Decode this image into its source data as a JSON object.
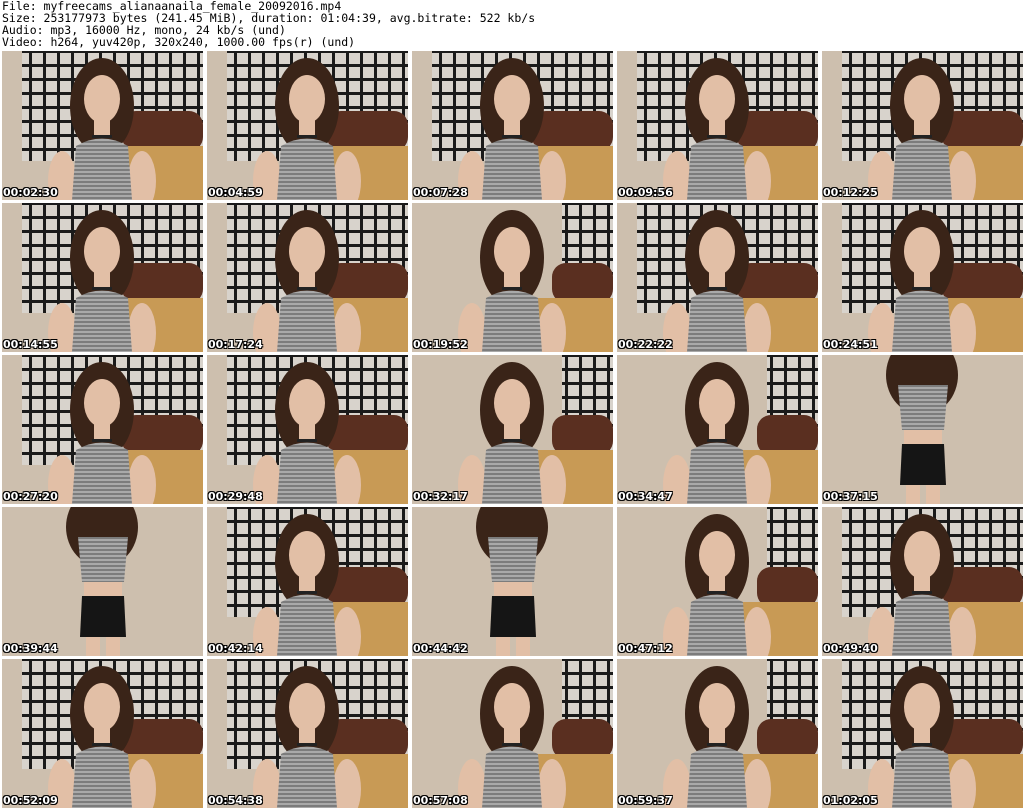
{
  "header": {
    "line1": "File: myfreecams_alianaanaila_female_20092016.mp4",
    "line2": "Size: 253177973 bytes (241.45 MiB), duration: 01:04:39, avg.bitrate: 522 kb/s",
    "line3": "Audio: mp3, 16000 Hz, mono, 24 kb/s (und)",
    "line4": "Video: h264, yuv420p, 320x240, 1000.00 fps(r) (und)"
  },
  "thumbnails": [
    {
      "time": "00:02:30",
      "scene": "seated-screen"
    },
    {
      "time": "00:04:59",
      "scene": "seated-screen"
    },
    {
      "time": "00:07:28",
      "scene": "seated-screen"
    },
    {
      "time": "00:09:56",
      "scene": "seated-screen"
    },
    {
      "time": "00:12:25",
      "scene": "seated-screen"
    },
    {
      "time": "00:14:55",
      "scene": "seated-screen"
    },
    {
      "time": "00:17:24",
      "scene": "seated-screen"
    },
    {
      "time": "00:19:52",
      "scene": "seated-wall"
    },
    {
      "time": "00:22:22",
      "scene": "seated-screen"
    },
    {
      "time": "00:24:51",
      "scene": "seated-screen"
    },
    {
      "time": "00:27:20",
      "scene": "seated-screen"
    },
    {
      "time": "00:29:48",
      "scene": "seated-screen"
    },
    {
      "time": "00:32:17",
      "scene": "seated-wall"
    },
    {
      "time": "00:34:47",
      "scene": "seated-wall"
    },
    {
      "time": "00:37:15",
      "scene": "standing-wall"
    },
    {
      "time": "00:39:44",
      "scene": "standing-wall"
    },
    {
      "time": "00:42:14",
      "scene": "seated-screen"
    },
    {
      "time": "00:44:42",
      "scene": "standing-wall"
    },
    {
      "time": "00:47:12",
      "scene": "seated-wall"
    },
    {
      "time": "00:49:40",
      "scene": "seated-screen"
    },
    {
      "time": "00:52:09",
      "scene": "seated-screen"
    },
    {
      "time": "00:54:38",
      "scene": "seated-screen"
    },
    {
      "time": "00:57:08",
      "scene": "seated-wall"
    },
    {
      "time": "00:59:37",
      "scene": "seated-wall"
    },
    {
      "time": "01:02:05",
      "scene": "seated-screen"
    }
  ],
  "colors": {
    "wall": "#cdbfae",
    "screen": "#1a1a1a",
    "bed": "#c89a55",
    "headboard": "#5a2f20",
    "hair": "#3a2418",
    "skin": "#e2bfa6",
    "top": "#7c7c7c",
    "skirt": "#151515"
  }
}
